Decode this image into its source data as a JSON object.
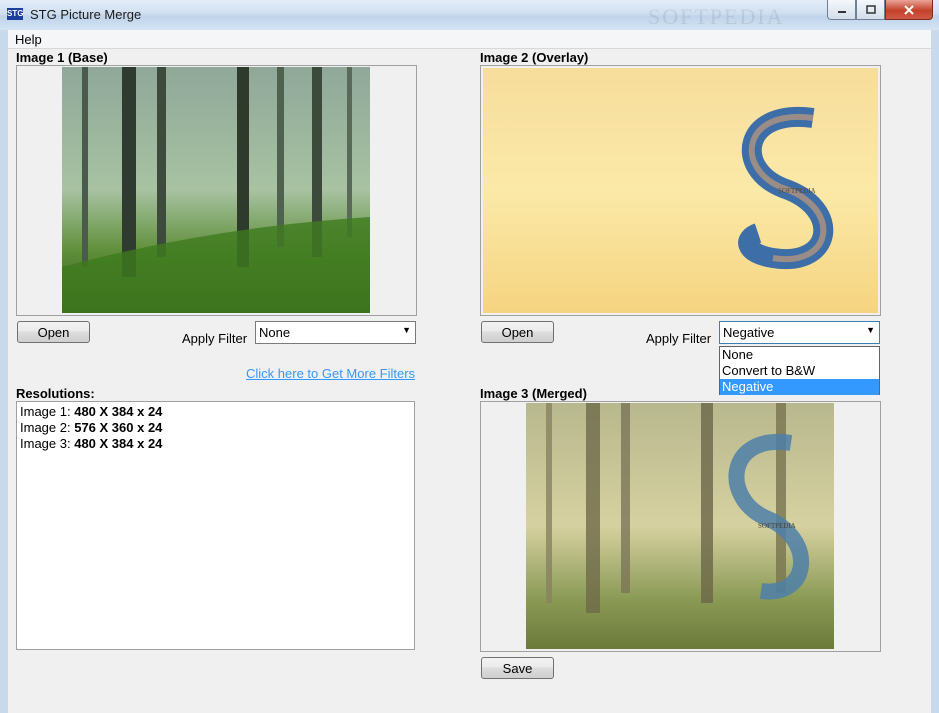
{
  "window": {
    "title": "STG Picture Merge",
    "icon_text": "STG",
    "watermark": "SOFTPEDIA"
  },
  "menu": {
    "help": "Help"
  },
  "image1": {
    "label": "Image 1 (Base)",
    "open_label": "Open",
    "filter_label": "Apply Filter",
    "filter_value": "None"
  },
  "image2": {
    "label": "Image 2 (Overlay)",
    "open_label": "Open",
    "filter_label": "Apply Filter",
    "filter_value": "Negative"
  },
  "image3": {
    "label": "Image 3 (Merged)",
    "save_label": "Save"
  },
  "filter_options": [
    "None",
    "Convert to B&W",
    "Negative"
  ],
  "more_filters_link": "Click here to Get More Filters",
  "resolutions": {
    "label": "Resolutions:",
    "lines": [
      {
        "prefix": "Image 1:",
        "value": "480 X 384 x 24"
      },
      {
        "prefix": "Image 2:",
        "value": "576 X 360 x 24"
      },
      {
        "prefix": "Image 3:",
        "value": "480 X 384 x 24"
      }
    ]
  },
  "image_text": {
    "softpedia": "SOFTPEDIA"
  },
  "colors": {
    "selection": "#3399ff",
    "link": "#3399ff"
  }
}
